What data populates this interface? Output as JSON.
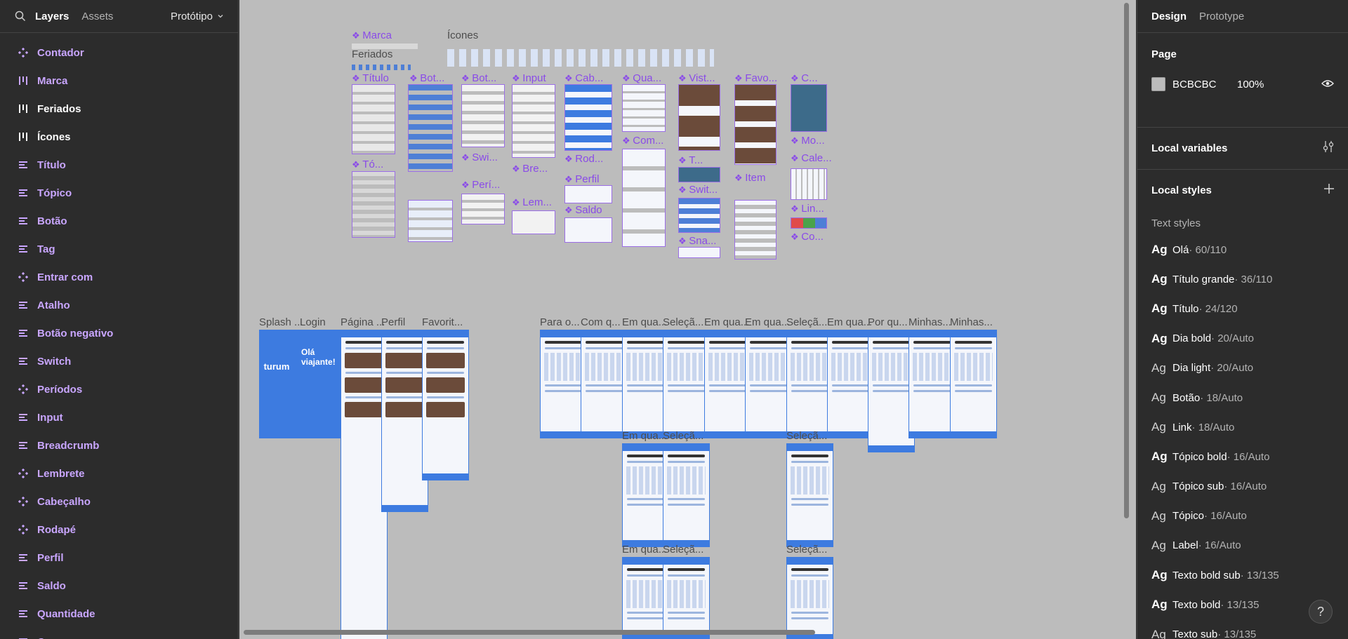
{
  "left_panel": {
    "tabs": [
      {
        "label": "Layers",
        "active": true
      },
      {
        "label": "Assets",
        "active": false
      }
    ],
    "page_selector": "Protótipo",
    "layers": [
      {
        "name": "Contador",
        "type": "component"
      },
      {
        "name": "Marca",
        "type": "frame-columns"
      },
      {
        "name": "Feriados",
        "type": "frame-columns"
      },
      {
        "name": "Ícones",
        "type": "frame-columns"
      },
      {
        "name": "Título",
        "type": "frame-rows"
      },
      {
        "name": "Tópico",
        "type": "frame-rows"
      },
      {
        "name": "Botão",
        "type": "frame-rows"
      },
      {
        "name": "Tag",
        "type": "frame-rows"
      },
      {
        "name": "Entrar com",
        "type": "component"
      },
      {
        "name": "Atalho",
        "type": "frame-rows"
      },
      {
        "name": "Botão negativo",
        "type": "frame-rows"
      },
      {
        "name": "Switch",
        "type": "frame-rows"
      },
      {
        "name": "Períodos",
        "type": "component"
      },
      {
        "name": "Input",
        "type": "frame-rows"
      },
      {
        "name": "Breadcrumb",
        "type": "frame-rows"
      },
      {
        "name": "Lembrete",
        "type": "component"
      },
      {
        "name": "Cabeçalho",
        "type": "component"
      },
      {
        "name": "Rodapé",
        "type": "component"
      },
      {
        "name": "Perfil",
        "type": "frame-rows"
      },
      {
        "name": "Saldo",
        "type": "frame-rows"
      },
      {
        "name": "Quantidade",
        "type": "frame-rows"
      },
      {
        "name": "Compra prog...",
        "type": "frame-rows"
      }
    ]
  },
  "canvas": {
    "background": "#BCBCBC",
    "section_titles": {
      "marca": "Marca",
      "icones": "Ícones",
      "feriados": "Feriados"
    },
    "components": {
      "titulo": "Título",
      "bot1": "Bot...",
      "bot2": "Bot...",
      "input": "Input",
      "cab": "Cab...",
      "qua": "Qua...",
      "vist": "Vist...",
      "favo": "Favo...",
      "c1": "C...",
      "com": "Com...",
      "mo": "Mo...",
      "cale": "Cale...",
      "swi": "Swi...",
      "bre": "Bre...",
      "rod": "Rod...",
      "t": "T...",
      "topico": "Tó...",
      "peri": "Perí...",
      "lem": "Lem...",
      "perfil": "Perfil",
      "swi2": "Swit...",
      "item": "Item",
      "lin": "Lin...",
      "saldo": "Saldo",
      "sna": "Sna...",
      "co": "Co..."
    },
    "frames_row1": [
      "Splash ...",
      "Login",
      "Página ...",
      "Perfil",
      "Favorit...",
      "Para o...",
      "Com q...",
      "Em qua...",
      "Seleçã...",
      "Em qua...",
      "Em qua...",
      "Seleçã...",
      "Em qua...",
      "Por qu...",
      "Minhas...",
      "Minhas..."
    ],
    "frames_row2": [
      "Em qua...",
      "Seleçã...",
      "Seleçã..."
    ],
    "frames_row3": [
      "Em qua...",
      "Seleçã...",
      "Seleçã..."
    ],
    "splash_text": "turum",
    "login_text": "Olá viajante!"
  },
  "right_panel": {
    "tabs": [
      {
        "label": "Design",
        "active": true
      },
      {
        "label": "Prototype",
        "active": false
      }
    ],
    "page": {
      "title": "Page",
      "color_hex": "BCBCBC",
      "opacity": "100%"
    },
    "local_variables": "Local variables",
    "local_styles": "Local styles",
    "text_styles_label": "Text styles",
    "text_styles": [
      {
        "name": "Olá",
        "meta": " · 60/110",
        "weight": "b"
      },
      {
        "name": "Título grande",
        "meta": " · 36/110",
        "weight": "b"
      },
      {
        "name": "Título",
        "meta": " · 24/120",
        "weight": "b"
      },
      {
        "name": "Dia bold",
        "meta": " · 20/Auto",
        "weight": "b"
      },
      {
        "name": "Dia light",
        "meta": " · 20/Auto",
        "weight": "l"
      },
      {
        "name": "Botão",
        "meta": " · 18/Auto",
        "weight": "l"
      },
      {
        "name": "Link",
        "meta": " · 18/Auto",
        "weight": "l"
      },
      {
        "name": "Tópico bold",
        "meta": " · 16/Auto",
        "weight": "b"
      },
      {
        "name": "Tópico sub",
        "meta": " · 16/Auto",
        "weight": "l"
      },
      {
        "name": "Tópico",
        "meta": " · 16/Auto",
        "weight": "l"
      },
      {
        "name": "Label",
        "meta": " · 16/Auto",
        "weight": "l"
      },
      {
        "name": "Texto bold sub",
        "meta": " · 13/135",
        "weight": "b"
      },
      {
        "name": "Texto bold",
        "meta": " · 13/135",
        "weight": "b"
      },
      {
        "name": "Texto sub",
        "meta": " · 13/135",
        "weight": "l"
      }
    ],
    "help": "?"
  }
}
